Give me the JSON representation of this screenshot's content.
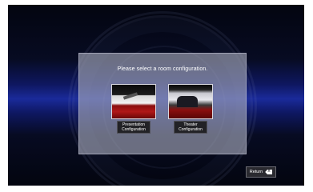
{
  "panel": {
    "prompt": "Please select a room configuration."
  },
  "options": [
    {
      "label": "Presentation\nConfiguration",
      "thumbnail": "presentation-room-photo"
    },
    {
      "label": "Theater\nConfiguration",
      "thumbnail": "theater-room-photo"
    }
  ],
  "return_button": {
    "label": "Return",
    "icon": "back-icon"
  }
}
